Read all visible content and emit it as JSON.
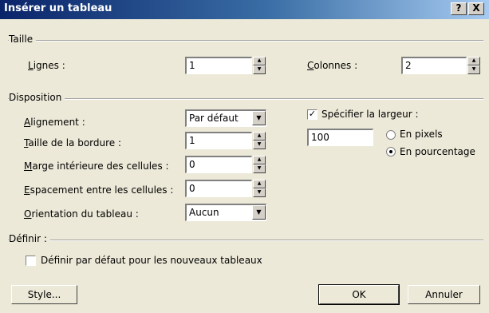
{
  "window": {
    "title": "Insérer un tableau",
    "help_button": "?",
    "close_button": "X"
  },
  "taille": {
    "group_label": "Taille",
    "lignes_label": "Lignes :",
    "lignes_value": "1",
    "colonnes_label": "Colonnes :",
    "colonnes_value": "2"
  },
  "disposition": {
    "group_label": "Disposition",
    "alignement_label": "Alignement :",
    "alignement_value": "Par défaut",
    "bordure_label": "Taille de la bordure :",
    "bordure_value": "1",
    "marge_label": "Marge intérieure des cellules :",
    "marge_value": "0",
    "espacement_label": "Espacement entre les cellules :",
    "espacement_value": "0",
    "orientation_label": "Orientation du tableau :",
    "orientation_value": "Aucun",
    "specifier_largeur_label": "Spécifier la largeur :",
    "specifier_largeur_checked": true,
    "largeur_value": "100",
    "en_pixels_label": "En pixels",
    "en_pourcentage_label": "En pourcentage",
    "selected_unit": "En pourcentage"
  },
  "definir": {
    "group_label": "Définir :",
    "default_checkbox_label": "Définir par défaut pour les nouveaux tableaux",
    "default_checked": false
  },
  "buttons": {
    "style": "Style...",
    "ok": "OK",
    "annuler": "Annuler"
  }
}
